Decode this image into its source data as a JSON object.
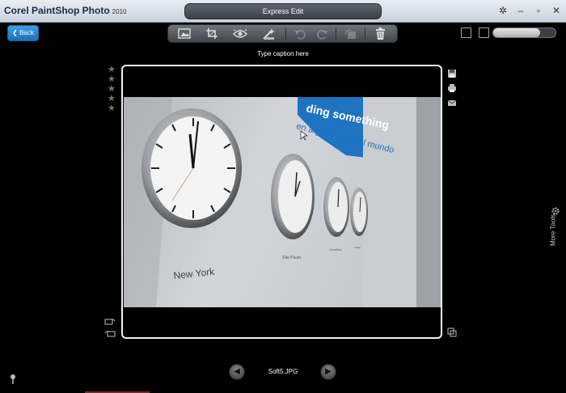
{
  "app": {
    "name": "Corel PaintShop Photo",
    "year": "2010"
  },
  "mode_label": "Express Edit",
  "back_label": "Back",
  "toolbar": {
    "tools": [
      "photo-tool-icon",
      "crop-icon",
      "red-eye-icon",
      "makeover-icon",
      "undo-icon",
      "redo-icon",
      "rotate-icon",
      "trash-icon"
    ]
  },
  "zoom_level": 0.75,
  "caption_placeholder": "Type caption here",
  "rating": {
    "stars": 5,
    "value": 0
  },
  "filename": "Soft5.JPG",
  "more_tools_label": "More Tools",
  "photo_text": {
    "wall_banner_1": "ding something",
    "wall_banner_2": "en algún lugar del mundo",
    "city_1": "New York",
    "city_2": "São Paulo",
    "city_3": "Londres",
    "city_4": "Tokio"
  },
  "colors": {
    "accent": "#1f7ac8",
    "banner": "#1f73c1"
  }
}
